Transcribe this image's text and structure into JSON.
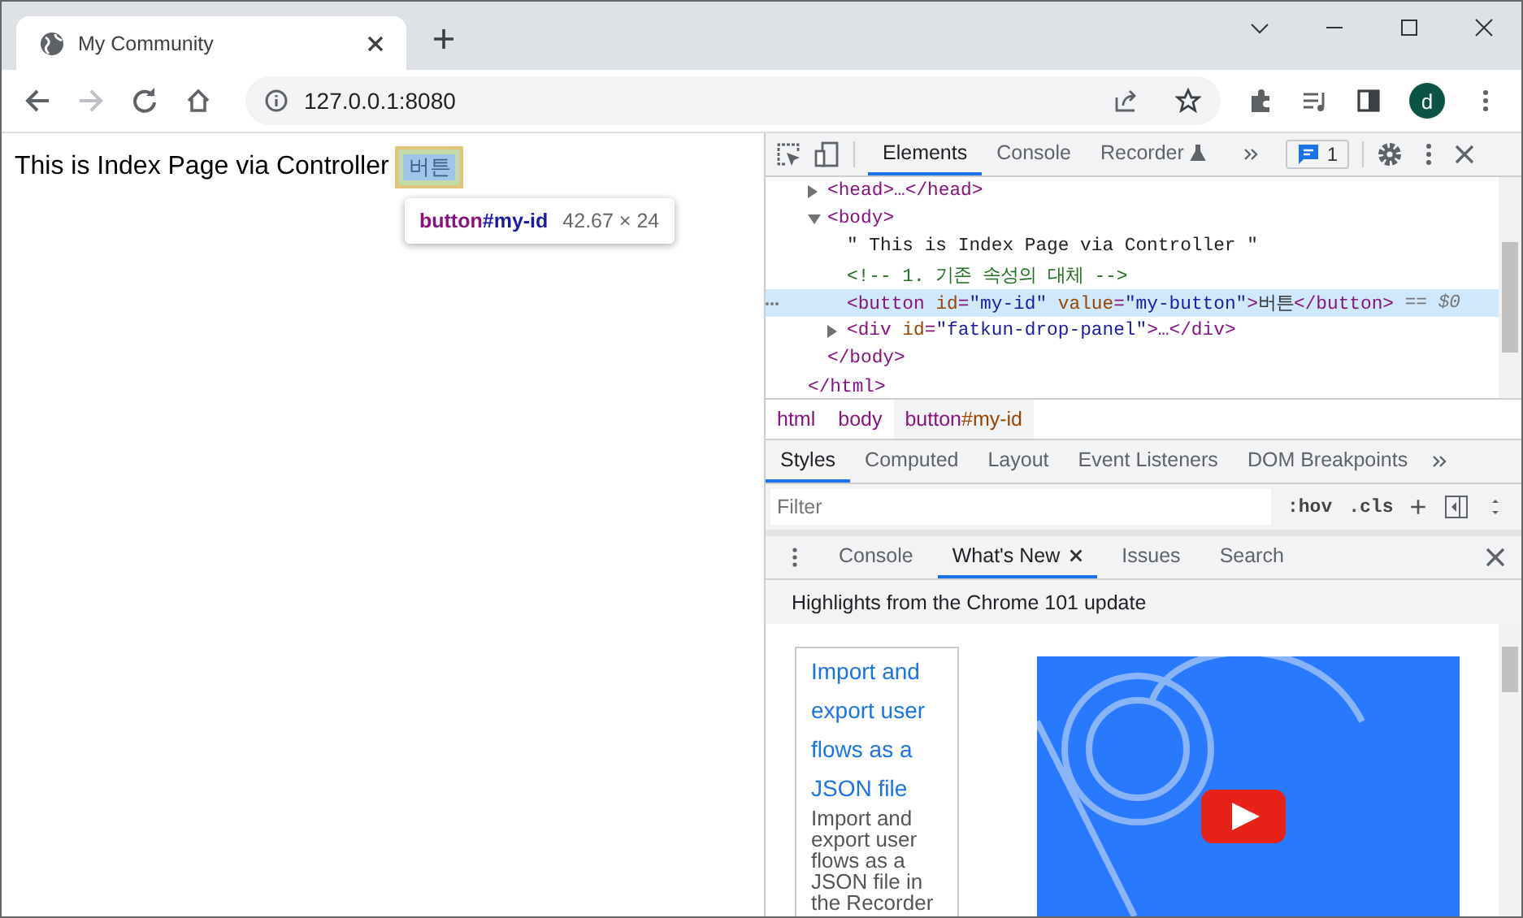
{
  "browser": {
    "tab": {
      "title": "My Community"
    },
    "address": "127.0.0.1:8080",
    "profile_initial": "d"
  },
  "page": {
    "text": "This is Index Page via Controller",
    "button": "버튼",
    "tooltip": {
      "tag": "button",
      "id": "#my-id",
      "size": "42.67 × 24"
    }
  },
  "devtools": {
    "tabs": [
      {
        "label": "Elements",
        "selected": true
      },
      {
        "label": "Console",
        "selected": false
      },
      {
        "label": "Recorder",
        "selected": false
      }
    ],
    "issues_count": "1",
    "dom_tree": {
      "closing": "</html>",
      "children": [
        {
          "kind": "element",
          "markup": "<head>…</head>",
          "expanded": false,
          "selected": false
        },
        {
          "kind": "element",
          "markup": "<body>",
          "expanded": true,
          "selected": false,
          "closing": "</body>",
          "children": [
            {
              "kind": "text",
              "markup": "\" This is Index Page via Controller \"",
              "selected": false
            },
            {
              "kind": "comment",
              "markup": "<!-- 1. 기존 속성의 대체 -->",
              "selected": false
            },
            {
              "kind": "element",
              "markup": "<button id=\"my-id\" value=\"my-button\">버튼</button>",
              "selected": true,
              "suffix": "== $0"
            },
            {
              "kind": "element",
              "markup": "<div id=\"fatkun-drop-panel\">…</div>",
              "expanded": false,
              "selected": false
            }
          ]
        }
      ]
    },
    "breadcrumbs": [
      {
        "tag": "html",
        "selected": false
      },
      {
        "tag": "body",
        "selected": false
      },
      {
        "tag": "button",
        "id": "#my-id",
        "selected": true
      }
    ],
    "styles_tabs": [
      {
        "label": "Styles",
        "selected": true
      },
      {
        "label": "Computed",
        "selected": false
      },
      {
        "label": "Layout",
        "selected": false
      },
      {
        "label": "Event Listeners",
        "selected": false
      },
      {
        "label": "DOM Breakpoints",
        "selected": false
      }
    ],
    "filter": {
      "placeholder": "Filter"
    },
    "hov": ":hov",
    "cls": ".cls",
    "plus": "+",
    "drawer_tabs": [
      {
        "label": "Console",
        "selected": false,
        "closable": false
      },
      {
        "label": "What's New",
        "selected": true,
        "closable": true
      },
      {
        "label": "Issues",
        "selected": false,
        "closable": false
      },
      {
        "label": "Search",
        "selected": false,
        "closable": false
      }
    ],
    "whats_new": {
      "heading": "Highlights from the Chrome 101 update",
      "link": "Import and export user flows as a JSON file",
      "description": "Import and export user flows as a JSON file in the Recorder"
    }
  }
}
